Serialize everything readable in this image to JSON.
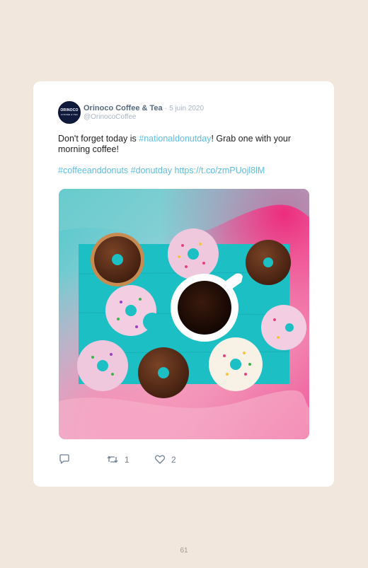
{
  "tweet": {
    "avatar_text": "ORINOCO",
    "avatar_sub": "COFFEE & TEA",
    "author_name": "Orinoco Coffee & Tea",
    "separator": "·",
    "date": "5 juin 2020",
    "handle": "@OrinocoCoffee",
    "text_before": "Don't forget today is ",
    "hashtag_inline": "#nationaldonutday",
    "text_after": "! Grab one with your morning coffee!",
    "tags_line": "#coffeeanddonuts #donutday https://t.co/zmPUojl8lM",
    "image_icon": "donuts-and-coffee-photo"
  },
  "actions": {
    "reply_icon": "reply-icon",
    "retweet_icon": "retweet-icon",
    "retweet_count": "1",
    "like_icon": "heart-icon",
    "like_count": "2"
  },
  "colors": {
    "page_bg": "#f2e7dc",
    "link": "#5fbde6",
    "name": "#56697d",
    "meta": "#a9b5c2"
  },
  "page_number": "61"
}
